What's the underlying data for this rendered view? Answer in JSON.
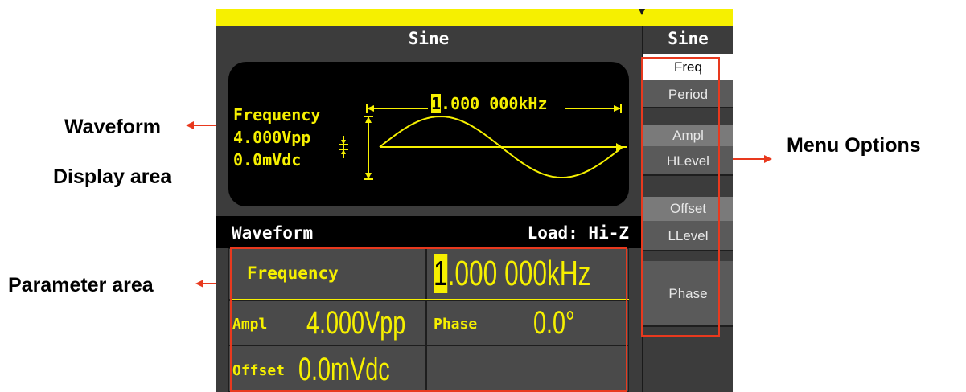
{
  "callouts": {
    "waveform": "Waveform",
    "display_area": "Display area",
    "parameter_area": "Parameter area",
    "menu_options": "Menu Options"
  },
  "screen": {
    "title": "Sine",
    "menu_title": "Sine"
  },
  "display": {
    "param_name": "Frequency",
    "amplitude": "4.000Vpp",
    "offset": "0.0mVdc",
    "freq_cursor_digit": "1",
    "freq_rest": ".000 000kHz"
  },
  "param_area": {
    "header_left": "Waveform",
    "header_right": "Load: Hi-Z",
    "frequency_label": "Frequency",
    "frequency_cursor_digit": "1",
    "frequency_rest": ".000 000kHz",
    "ampl_label": "Ampl",
    "ampl_value": "4.000Vpp",
    "phase_label": "Phase",
    "phase_value": "0.0°",
    "offset_label": "Offset",
    "offset_value": "0.0mVdc"
  },
  "menu": {
    "items": [
      "Freq",
      "Period",
      "Ampl",
      "HLevel",
      "Offset",
      "LLevel",
      "Phase"
    ],
    "selected": "Freq"
  },
  "colors": {
    "accent_yellow": "#f6f000",
    "callout_red": "#e8391e",
    "panel_bg": "#3c3c3c"
  }
}
